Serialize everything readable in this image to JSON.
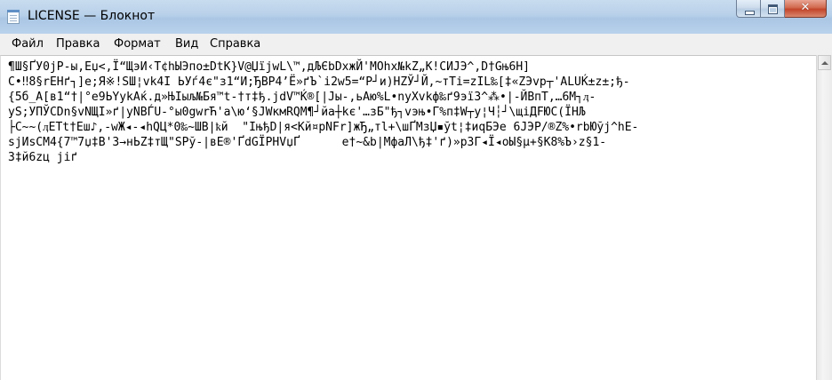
{
  "window": {
    "title": "LICENSE — Блокнот",
    "icon": "notepad-icon",
    "controls": {
      "minimize_icon": "minimize-icon",
      "maximize_icon": "maximize-icon",
      "close_label": "✕"
    }
  },
  "menu": {
    "file": "Файл",
    "edit": "Правка",
    "format": "Формат",
    "view": "Вид",
    "help": "Справка"
  },
  "editor": {
    "lines": [
      "¶Ш§ҐУ0jР-ы,Eџ<,Ї“ЩэИ‹Т¢hЫЭпо±DtK}V@ЏїjwL\\™,дЉЄbDxжЙ'MOhx№kZ„K!СИЈЭ^,D†Gњ6Н]",
      "С•‼8§rEHґ┐]е;Я※!SШ¦vk4I ЬУѓ4є\"з1“И;ЂВР4’Ё»ґЪ`i2w5=“Р┘и)HZЎ┘Й,~тТі=zIL‰[‡«ZЭvp┬'ALUЌ±z±;ђ-",
      "{5б_A[в1“†|°e9ЬYykАќ.д»ЊІыљ№Бя™t-†т‡ђ.jdV™Ќ®[|Јы-,ьАю%L•nyXvkф‰ґ9эї3^⁂•|-ЙВпТ,…6М┐ӆ-",
      "yS;УПЎСDn§vNЩІ»ґ|yNBЃU-°ы0gwrЋ'a\\ю‘§JWкмRQM¶┘йа┼kє'…зБ\"ђ┐vэњ•Г%п‡W┬у¦Ч┆┘\\щiДFЮС(ЇНЉ",
      "├С~~(ӆЕTt†Eш♪,-wЖ◂-◂hQЦ*0‰~ШВ|ҟй  \"IњђD|я<Кй¤рNFr]жЂ„тl+\\шҐМзЏ▪ўt¦‡иqБЭе 6JЭP/®Z%•rbЮўj^hE-",
      "sјИsСМ4{7™7џ‡В'З→нЬZ‡тЩ\"SPў-|вЕ®'ҐdGЇPHVџҐ      е†~&b|МфаЛ\\ђ‡'ґ)»р3Г◂Ї◂оЫ§µ+§K8%Ъ›z§1-",
      "3‡й6zц јiґ"
    ]
  },
  "scrollbar": {
    "up_arrow_icon": "arrow-up-icon"
  }
}
